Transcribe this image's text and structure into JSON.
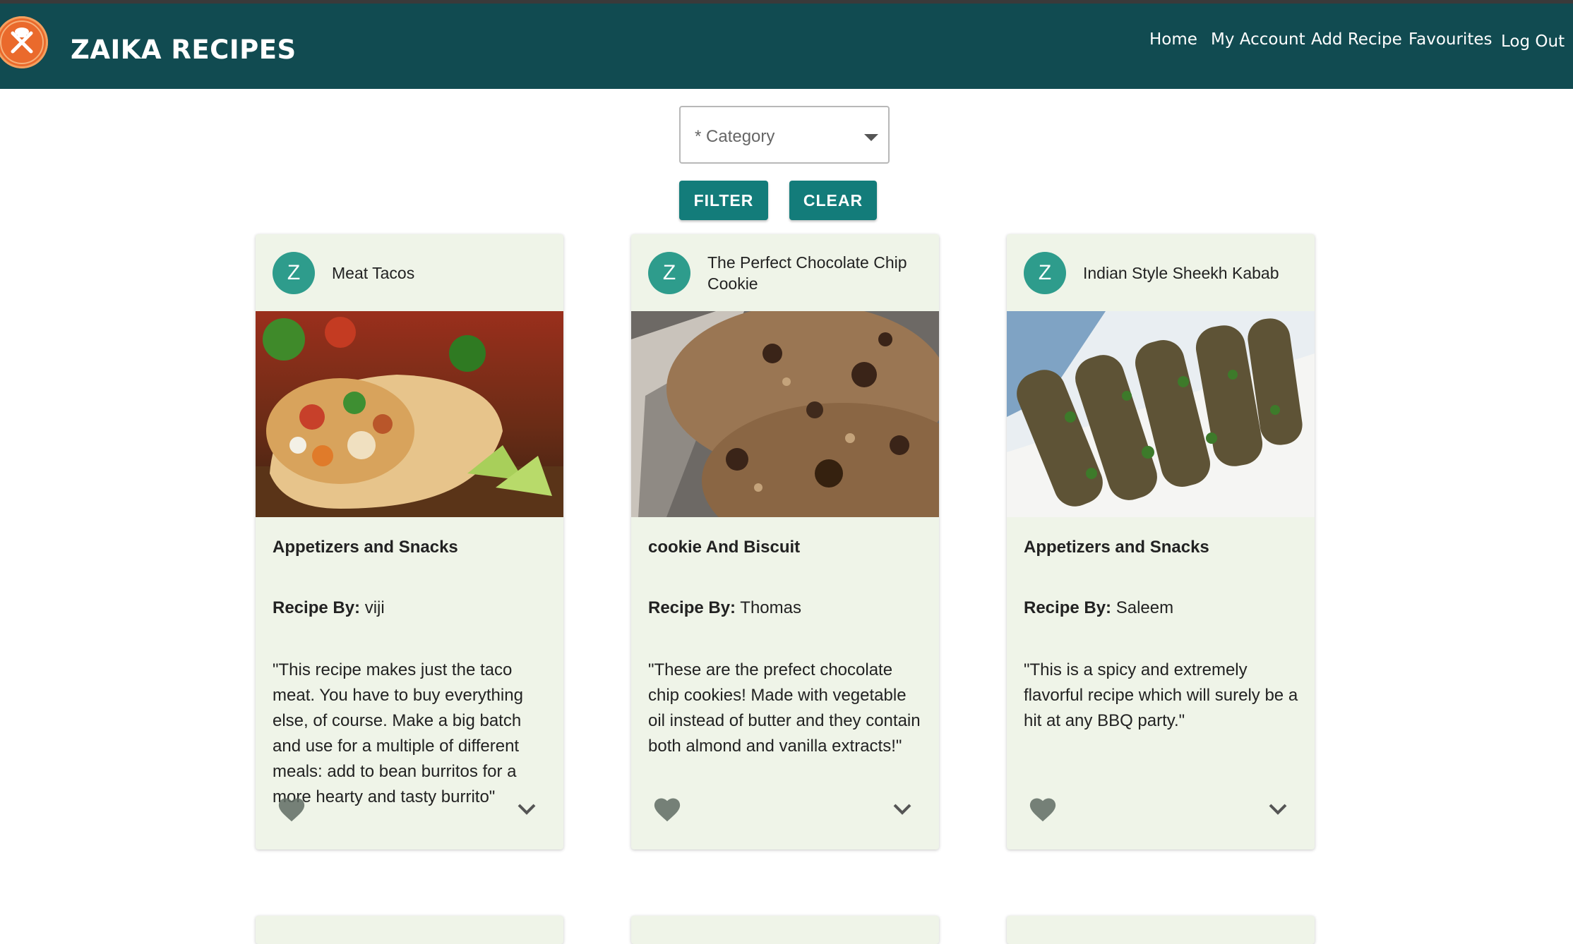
{
  "header": {
    "brand": "ZAIKA RECIPES",
    "nav": [
      "Home",
      "My Account",
      "Add Recipe",
      "Favourites",
      "Log Out"
    ]
  },
  "filter": {
    "category_placeholder": "* Category",
    "filter_label": "FILTER",
    "clear_label": "CLEAR"
  },
  "recipes": [
    {
      "avatar": "Z",
      "title": "Meat Tacos",
      "category": "Appetizers and Snacks",
      "by_label": "Recipe By:",
      "author": "viji",
      "description": "\"This recipe makes just the taco meat. You have to buy everything else, of course. Make a big batch and use for a multiple of different meals: add to bean burritos for a more hearty and tasty burrito\""
    },
    {
      "avatar": "Z",
      "title": "The Perfect Chocolate Chip Cookie",
      "category": "cookie And Biscuit",
      "by_label": "Recipe By:",
      "author": "Thomas",
      "description": "\"These are the prefect chocolate chip cookies! Made with vegetable oil instead of butter and they contain both almond and vanilla extracts!\""
    },
    {
      "avatar": "Z",
      "title": "Indian Style Sheekh Kabab",
      "category": "Appetizers and Snacks",
      "by_label": "Recipe By:",
      "author": "Saleem",
      "description": "\"This is a spicy and extremely flavorful recipe which will surely be a hit at any BBQ party.\""
    }
  ],
  "colors": {
    "appbar": "#114b51",
    "button": "#137c7a",
    "card": "#eff4e8",
    "avatar": "#2e9c8c",
    "logo": "#ea6a2c"
  },
  "icons": [
    "chef-logo-icon",
    "dropdown-caret-icon",
    "heart-icon",
    "chevron-down-icon"
  ]
}
